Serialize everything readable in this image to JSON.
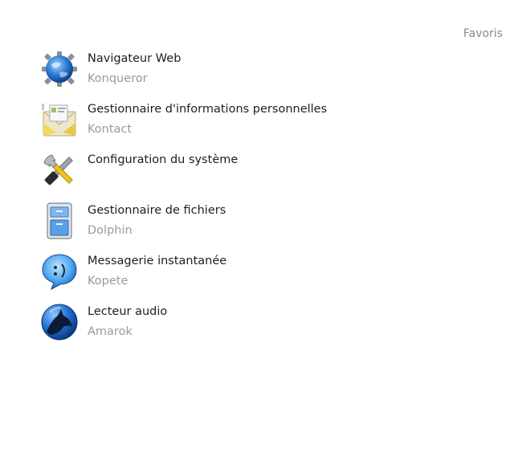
{
  "header": {
    "favorites_label": "Favoris"
  },
  "favorites": [
    {
      "title": "Navigateur Web",
      "subtitle": "Konqueror",
      "icon": "web-browser-icon"
    },
    {
      "title": "Gestionnaire d'informations personnelles",
      "subtitle": "Kontact",
      "icon": "personal-info-manager-icon"
    },
    {
      "title": "Configuration du système",
      "subtitle": "",
      "icon": "system-settings-icon"
    },
    {
      "title": "Gestionnaire de fichiers",
      "subtitle": "Dolphin",
      "icon": "file-manager-icon"
    },
    {
      "title": "Messagerie instantanée",
      "subtitle": "Kopete",
      "icon": "instant-messenger-icon"
    },
    {
      "title": "Lecteur audio",
      "subtitle": "Amarok",
      "icon": "audio-player-icon"
    }
  ],
  "colors": {
    "title_text": "#1e1e1e",
    "subtitle_text": "#9a9a9a",
    "header_text": "#8a8a8a",
    "background": "#ffffff"
  }
}
